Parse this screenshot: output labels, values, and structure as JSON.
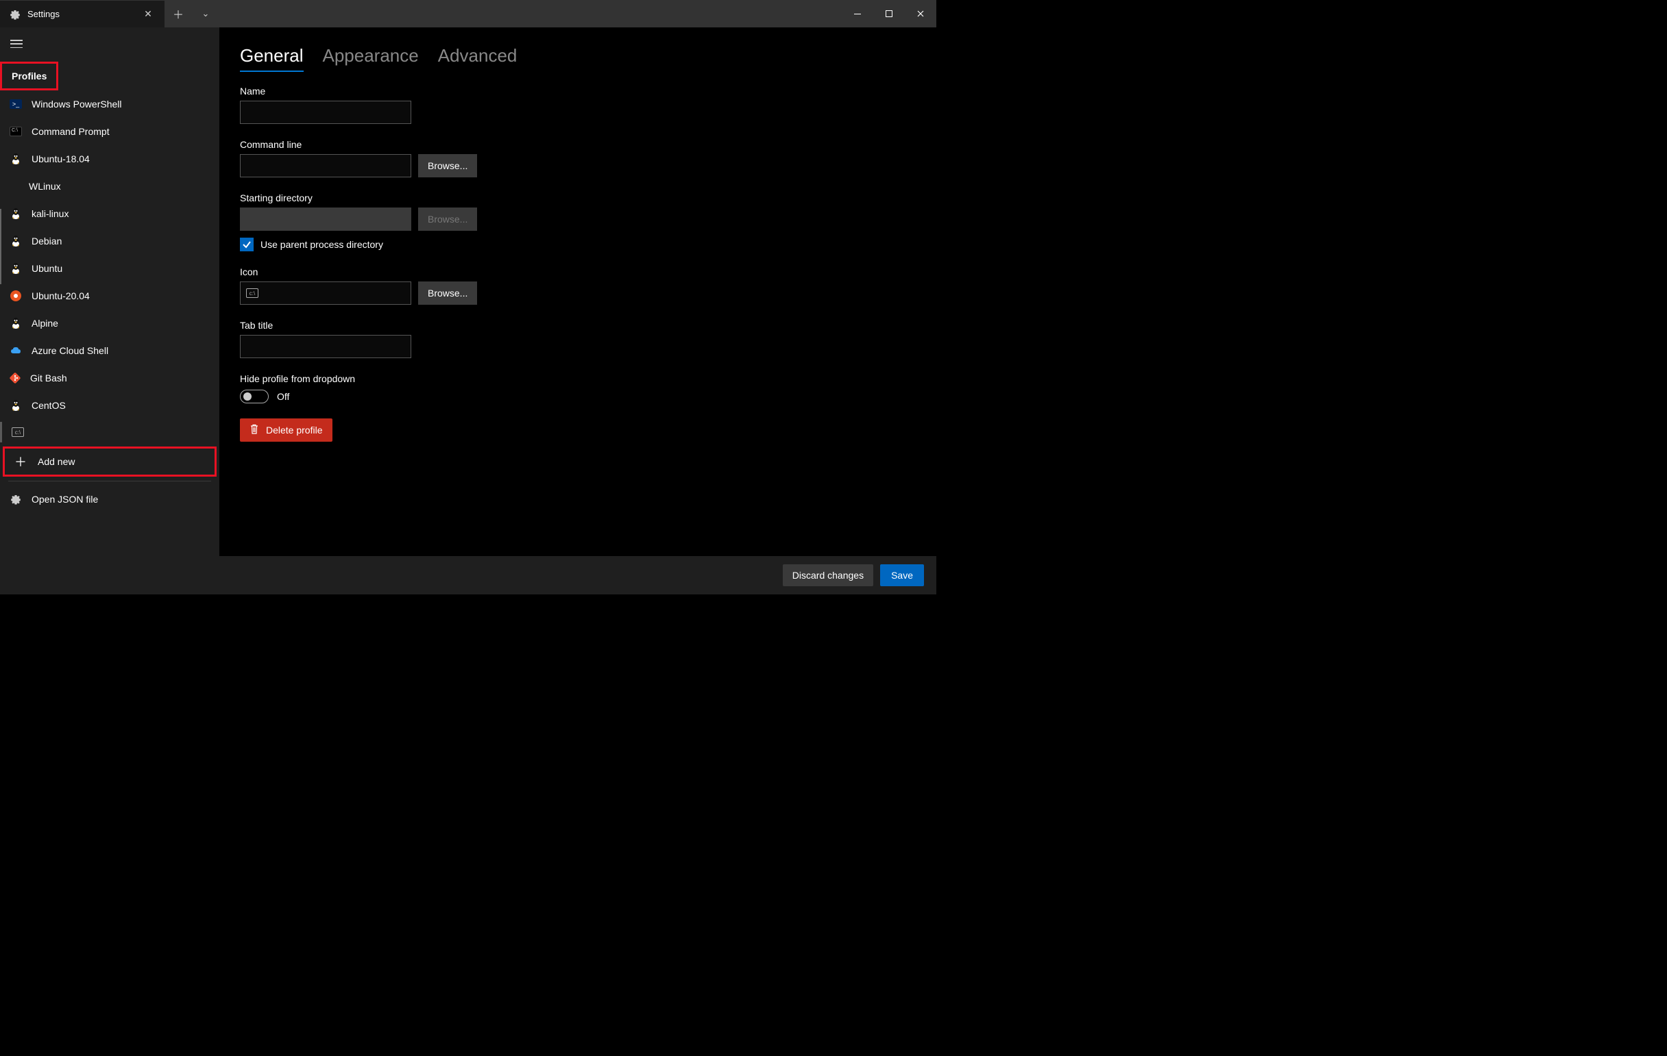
{
  "titlebar": {
    "tab_title": "Settings"
  },
  "sidebar": {
    "heading": "Profiles",
    "profiles": [
      {
        "label": "Windows PowerShell",
        "icon": "powershell"
      },
      {
        "label": "Command Prompt",
        "icon": "cmd"
      },
      {
        "label": "Ubuntu-18.04",
        "icon": "tux"
      },
      {
        "label": "WLinux",
        "icon": "none",
        "indented": true
      },
      {
        "label": "kali-linux",
        "icon": "tux"
      },
      {
        "label": "Debian",
        "icon": "tux"
      },
      {
        "label": "Ubuntu",
        "icon": "tux"
      },
      {
        "label": "Ubuntu-20.04",
        "icon": "ubuntu"
      },
      {
        "label": "Alpine",
        "icon": "tux"
      },
      {
        "label": "Azure Cloud Shell",
        "icon": "azure"
      },
      {
        "label": "Git Bash",
        "icon": "git"
      },
      {
        "label": "CentOS",
        "icon": "tux"
      }
    ],
    "add_new": "Add new",
    "open_json": "Open JSON file"
  },
  "tabs": {
    "general": "General",
    "appearance": "Appearance",
    "advanced": "Advanced"
  },
  "form": {
    "name_label": "Name",
    "name_value": "",
    "cmdline_label": "Command line",
    "cmdline_value": "",
    "browse": "Browse...",
    "startdir_label": "Starting directory",
    "startdir_value": "",
    "use_parent": "Use parent process directory",
    "icon_label": "Icon",
    "tabtitle_label": "Tab title",
    "tabtitle_value": "",
    "hide_label": "Hide profile from dropdown",
    "hide_state": "Off",
    "delete": "Delete profile"
  },
  "footer": {
    "discard": "Discard changes",
    "save": "Save"
  }
}
